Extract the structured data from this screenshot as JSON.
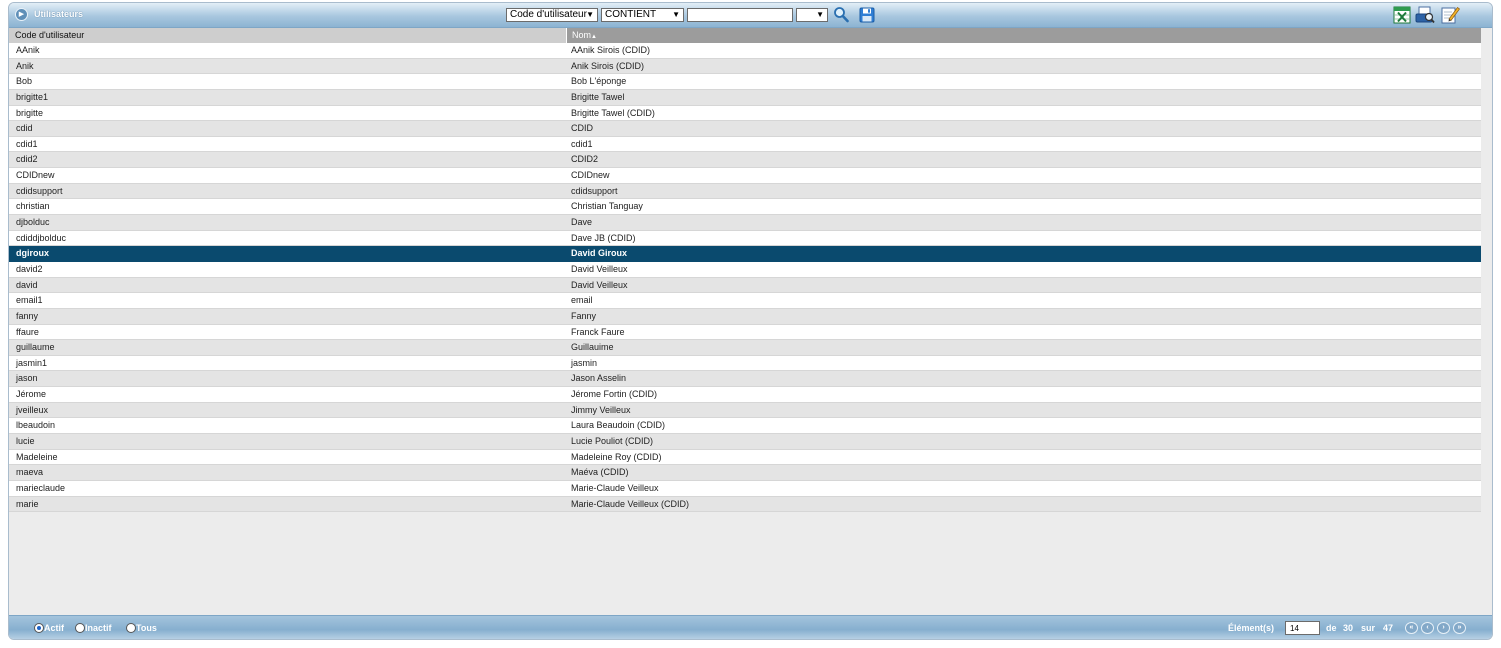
{
  "header": {
    "title": "Utilisateurs",
    "filter_field": "Code d'utilisateur",
    "filter_operator": "CONTIENT",
    "filter_value": "",
    "filter_extra": ""
  },
  "table": {
    "columns": [
      "Code d'utilisateur",
      "Nom"
    ],
    "sort_column": "Nom",
    "sort_direction": "ascending",
    "selected_index": 13,
    "rows": [
      {
        "code": "AAnik",
        "nom": "AAnik Sirois (CDID)"
      },
      {
        "code": "Anik",
        "nom": "Anik Sirois (CDID)"
      },
      {
        "code": "Bob",
        "nom": "Bob L'éponge"
      },
      {
        "code": "brigitte1",
        "nom": "Brigitte Tawel"
      },
      {
        "code": "brigitte",
        "nom": "Brigitte Tawel (CDID)"
      },
      {
        "code": "cdid",
        "nom": "CDID"
      },
      {
        "code": "cdid1",
        "nom": "cdid1"
      },
      {
        "code": "cdid2",
        "nom": "CDID2"
      },
      {
        "code": "CDIDnew",
        "nom": "CDIDnew"
      },
      {
        "code": "cdidsupport",
        "nom": "cdidsupport"
      },
      {
        "code": "christian",
        "nom": "Christian Tanguay"
      },
      {
        "code": "djbolduc",
        "nom": "Dave"
      },
      {
        "code": "cdiddjbolduc",
        "nom": "Dave JB (CDID)"
      },
      {
        "code": "dgiroux",
        "nom": "David Giroux"
      },
      {
        "code": "david2",
        "nom": "David Veilleux"
      },
      {
        "code": "david",
        "nom": "David Veilleux"
      },
      {
        "code": "email1",
        "nom": "email"
      },
      {
        "code": "fanny",
        "nom": "Fanny"
      },
      {
        "code": "ffaure",
        "nom": "Franck Faure"
      },
      {
        "code": "guillaume",
        "nom": "Guillauime"
      },
      {
        "code": "jasmin1",
        "nom": "jasmin"
      },
      {
        "code": "jason",
        "nom": "Jason Asselin"
      },
      {
        "code": "Jérome",
        "nom": "Jérome Fortin (CDID)"
      },
      {
        "code": "jveilleux",
        "nom": "Jimmy Veilleux"
      },
      {
        "code": "lbeaudoin",
        "nom": "Laura Beaudoin (CDID)"
      },
      {
        "code": "lucie",
        "nom": "Lucie Pouliot (CDID)"
      },
      {
        "code": "Madeleine",
        "nom": "Madeleine Roy (CDID)"
      },
      {
        "code": "maeva",
        "nom": "Maéva (CDID)"
      },
      {
        "code": "marieclaude",
        "nom": "Marie-Claude Veilleux"
      },
      {
        "code": "marie",
        "nom": "Marie-Claude Veilleux (CDID)"
      }
    ]
  },
  "footer": {
    "status_options": [
      "Actif",
      "Inactif",
      "Tous"
    ],
    "status_selected": "Actif",
    "elements_label": "Élément(s)",
    "current_element": "14",
    "de_label": "de",
    "page_total": "30",
    "sur_label": "sur",
    "total_count": "47"
  },
  "icons": {
    "collapse": "collapse-icon",
    "search": "magnifier-icon",
    "save": "floppy-disk-icon",
    "excel": "excel-icon",
    "print": "print-preview-icon",
    "edit": "edit-icon",
    "first": "first-page-icon",
    "prev": "previous-page-icon",
    "next": "next-page-icon",
    "last": "last-page-icon"
  },
  "colors": {
    "header_gradient_top": "#e3eef7",
    "header_gradient_bottom": "#8cb3d2",
    "selected_row": "#0a4a6e",
    "sorted_column_header": "#9c9c9c",
    "row_alt": "#e4e4e4"
  }
}
